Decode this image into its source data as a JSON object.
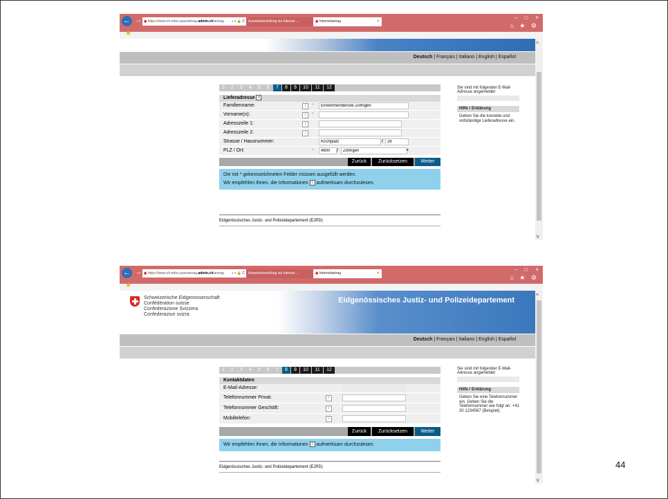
{
  "page_number": "44",
  "browser": {
    "address_prefix": "https://www.ch-edoc-passantrag.",
    "address_domain": "admin.ch",
    "address_suffix": "/antrag",
    "address_controls": "⌕ ▾ 🔒 C",
    "tab1_label": "Ausweisbestellung via Internet ...",
    "tab2_label": "Internetantrag",
    "tab_close": "×",
    "back_icon": "←",
    "forward_icon": "→",
    "toolbar_icons": "⌂ ★ ⚙",
    "win_min": "–",
    "win_max": "□",
    "win_close": "×",
    "fav_star": "★",
    "scroll_up": "^",
    "scroll_down": "˅"
  },
  "header": {
    "org_lines": [
      "Schweizerische Eidgenossenschaft",
      "Confédération suisse",
      "Confederazione Svizzera",
      "Confederaziun svizra"
    ],
    "department": "Eidgenössisches Justiz- und Polizeidepartement"
  },
  "languages": {
    "active": "Deutsch",
    "sep": "|",
    "others": [
      "Français",
      "Italiano",
      "English",
      "Español"
    ]
  },
  "shot1": {
    "steps": [
      "1",
      "2",
      "3",
      "4",
      "5",
      "6",
      "7",
      "8",
      "9",
      "10",
      "11",
      "12"
    ],
    "current_step": "7",
    "section_title": "Lieferadresse",
    "section_info": "i",
    "fields": {
      "familienname": {
        "label": "Familienname:",
        "value": "Einwohnerdienste Zofingen",
        "required": "*"
      },
      "vorname": {
        "label": "Vorname(n):",
        "value": "",
        "required": "*"
      },
      "adresse1": {
        "label": "Adresszeile 1:",
        "value": ""
      },
      "adresse2": {
        "label": "Adresszeile 2:",
        "value": ""
      },
      "strasse": {
        "label": "Strasse / Hausnummer:",
        "street": "Kirchplatz",
        "sep": "/",
        "number": "26"
      },
      "plz": {
        "label": "PLZ / Ort:",
        "required": "*",
        "plz": "4800",
        "sep": "/",
        "ort": "Zofingen",
        "clear": "×"
      }
    },
    "info_glyph": "i",
    "buttons": {
      "back": "Zurück",
      "reset": "Zurücksetzen",
      "next": "Weiter"
    },
    "note_line1": "Die mit * gekennzeichneten Felder müssen ausgefüllt werden.",
    "note_line2_a": "Wir empfehlen Ihnen, die Informationen",
    "note_line2_b": "aufmerksam durchzulesen.",
    "footer": "Eidgenössisches Justiz- und Polizeidepartement (EJPD)",
    "sidebar_login": "Sie sind mit folgender E-Mail-Adresse angemeldet",
    "sidebar_help_title": "Hilfe / Erklärung",
    "sidebar_help_text": "Geben Sie die korrekte und vollständige Lieferadresse ein."
  },
  "shot2": {
    "steps": [
      "1",
      "2",
      "3",
      "4",
      "5",
      "6",
      "7",
      "8",
      "9",
      "10",
      "11",
      "12"
    ],
    "current_step": "8",
    "section_title": "Kontaktdaten",
    "fields": {
      "email": {
        "label": "E-Mail-Adresse:",
        "value": ""
      },
      "tel_privat": {
        "label": "Telefonnummer Privat:",
        "value": ""
      },
      "tel_geschaeft": {
        "label": "Telefonnummer Geschäft:",
        "value": ""
      },
      "mobile": {
        "label": "Mobiltelefon:",
        "value": ""
      }
    },
    "info_glyph": "i",
    "buttons": {
      "back": "Zurück",
      "reset": "Zurücksetzen",
      "next": "Weiter"
    },
    "note_a": "Wir empfehlen Ihnen, die Informationen",
    "note_b": "aufmerksam durchzulesen.",
    "footer": "Eidgenössisches Justiz- und Polizeidepartement (EJPD)",
    "sidebar_login": "Sie sind mit folgender E-Mail-Adresse angemeldet",
    "sidebar_help_title": "Hilfe / Erklärung",
    "sidebar_help_text": "Geben Sie eine Telefonnummer ein. Geben Sie die Telefonnummer wie folgt an: +41 30 1234567 (Beispiel)."
  }
}
